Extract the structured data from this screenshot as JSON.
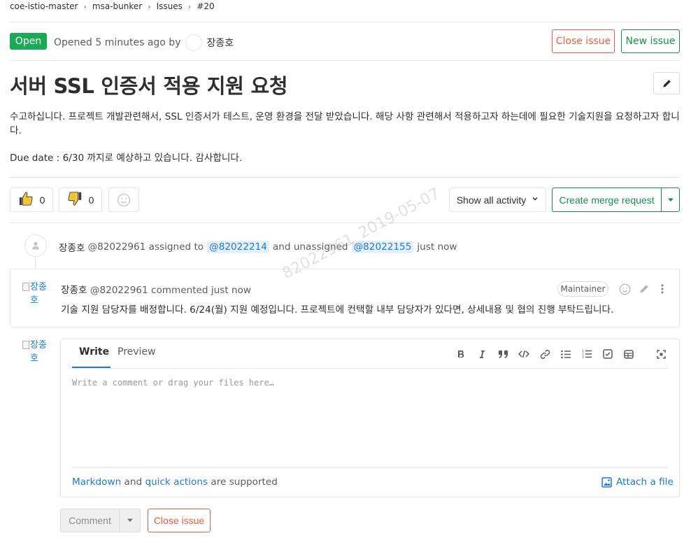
{
  "breadcrumb": [
    "coe-istio-master",
    "msa-bunker",
    "Issues",
    "#20"
  ],
  "header": {
    "status": "Open",
    "opened_text": "Opened 5 minutes ago by",
    "author": "장종호",
    "close_issue": "Close issue",
    "new_issue": "New issue"
  },
  "issue": {
    "title": "서버 SSL 인증서 적용 지원 요청",
    "description": [
      "수고하십니다. 프로젝트 개발관련해서, SSL 인증서가 테스트, 운영 환경을 전달 받았습니다. 해당 사항 관련해서 적용하고자 하는데에 필요한 기술지원을 요청하고자 합니다.",
      "Due date : 6/30 까지로 예상하고 있습니다. 감사합니다."
    ]
  },
  "awards": {
    "thumbsup_count": "0",
    "thumbsdown_count": "0"
  },
  "activity": {
    "filter_label": "Show all activity",
    "merge_request_label": "Create merge request"
  },
  "system_note": {
    "author": "장종호",
    "text_before": "@82022961 assigned to",
    "mention1": "@82022214",
    "text_middle": "and unassigned",
    "mention2": "@82022155",
    "time": "just now"
  },
  "comment": {
    "avatar_alt": "장종호",
    "author": "장종호",
    "meta": "@82022961 commented just now",
    "role": "Maintainer",
    "body": "기술 지원 담당자를 배정합니다. 6/24(월) 지원 예정입니다. 프로젝트에 컨택할 내부 담당자가 있다면, 상세내용 및 협의 진행 부탁드립니다."
  },
  "reply": {
    "avatar_alt": "장종호",
    "tab_write": "Write",
    "tab_preview": "Preview",
    "placeholder": "Write a comment or drag your files here…",
    "markdown_link": "Markdown",
    "and_text": "and",
    "quick_actions_link": "quick actions",
    "supported_text": "are supported",
    "attach_label": "Attach a file",
    "comment_button": "Comment",
    "close_button": "Close issue"
  },
  "watermark": "82022961_2019-05-07",
  "colors": {
    "open_badge": "#1aaa55",
    "danger": "#e75e40",
    "success": "#168f48",
    "link": "#1f78d1"
  },
  "icons": [
    "pencil-icon",
    "thumbsup-icon",
    "thumbsdown-icon",
    "smiley-icon",
    "chevron-down-icon",
    "user-icon",
    "bold-icon",
    "italic-icon",
    "quote-icon",
    "code-icon",
    "link-icon",
    "bullet-list-icon",
    "numbered-list-icon",
    "task-list-icon",
    "table-icon",
    "fullscreen-icon",
    "attach-image-icon"
  ]
}
